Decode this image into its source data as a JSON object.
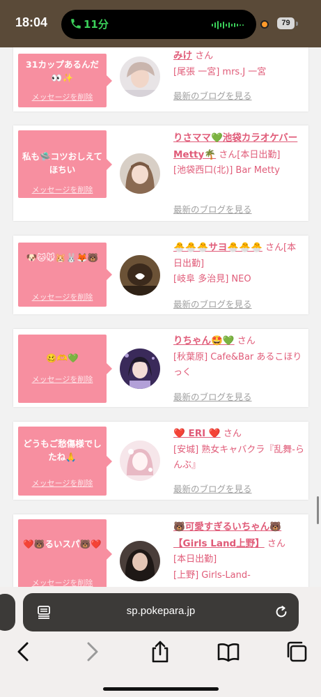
{
  "status_bar": {
    "time": "18:04",
    "call_duration": "11分",
    "battery": "79"
  },
  "cards": [
    {
      "message": "31カップあるんだ👀✨",
      "delete": "メッセージを削除",
      "name": "みけ",
      "san": "さん",
      "shop": "[尾張 一宮] mrs.J 一宮",
      "blog": "最新のブログを見る",
      "avatar_colors": [
        "#e8e4e6",
        "#c9b5ad"
      ]
    },
    {
      "message": "私も🛸コツおしえてほちい",
      "delete": "メッセージを削除",
      "name": "りさママ💚池袋カラオケバーMetty🌴",
      "san": "さん[本日出勤]",
      "shop": "[池袋西口(北)] Bar Metty",
      "blog": "最新のブログを見る",
      "avatar_colors": [
        "#d8cfc6",
        "#8a6a52"
      ]
    },
    {
      "message": "🐶🐱🐭🐹🐰🦊🐻",
      "delete": "メッセージを削除",
      "name": "🐣🐣🐣サヨ🐣🐣🐣",
      "san": "さん[本日出勤]",
      "shop": "[岐阜 多治見] NEO",
      "blog": "最新のブログを見る",
      "avatar_colors": [
        "#6b5236",
        "#2f2216"
      ]
    },
    {
      "message": "🥴🫶💚",
      "delete": "メッセージを削除",
      "name": "りちゃん🤩💚",
      "san": "さん",
      "shop": "[秋葉原] Cafe&Bar あるこほりっく",
      "blog": "最新のブログを見る",
      "avatar_colors": [
        "#3a2a5a",
        "#b2a0d8"
      ]
    },
    {
      "message": "どうもご愁傷様でしたね🙏",
      "delete": "メッセージを削除",
      "name": "❤️ ERI ❤️",
      "san": "さん",
      "shop": "[安城] 熟女キャバクラ『乱舞-らんぶ』",
      "blog": "最新のブログを見る",
      "avatar_colors": [
        "#f6e6ea",
        "#e8b9c4"
      ]
    },
    {
      "message": "❤️🐻るいスパ🐻❤️",
      "delete": "メッセージを削除",
      "name": "🐻可愛すぎるいちゃん🐻【Girls Land上野】",
      "san": "さん",
      "shop": "[本日出勤]",
      "shop2": "[上野] Girls-Land-",
      "blog": "",
      "avatar_colors": [
        "#4a3e3a",
        "#1e1816"
      ]
    }
  ],
  "browser": {
    "url": "sp.pokepara.jp"
  },
  "icons": [
    "phone-icon",
    "reader-icon",
    "reload-icon",
    "back-icon",
    "forward-icon",
    "share-icon",
    "bookmarks-icon",
    "tabs-icon"
  ]
}
